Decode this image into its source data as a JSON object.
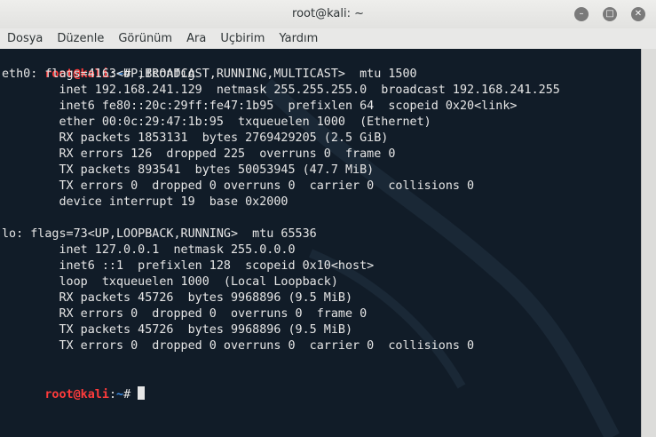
{
  "window": {
    "title": "root@kali: ~"
  },
  "menu": [
    "Dosya",
    "Düzenle",
    "Görünüm",
    "Ara",
    "Uçbirim",
    "Yardım"
  ],
  "terminal": {
    "prompt_user": "root@kali",
    "prompt_sep": ":",
    "prompt_path": "~",
    "prompt_symbol": "# ",
    "command": "ifconfig",
    "output": [
      "eth0: flags=4163<UP,BROADCAST,RUNNING,MULTICAST>  mtu 1500",
      "        inet 192.168.241.129  netmask 255.255.255.0  broadcast 192.168.241.255",
      "        inet6 fe80::20c:29ff:fe47:1b95  prefixlen 64  scopeid 0x20<link>",
      "        ether 00:0c:29:47:1b:95  txqueuelen 1000  (Ethernet)",
      "        RX packets 1853131  bytes 2769429205 (2.5 GiB)",
      "        RX errors 126  dropped 225  overruns 0  frame 0",
      "        TX packets 893541  bytes 50053945 (47.7 MiB)",
      "        TX errors 0  dropped 0 overruns 0  carrier 0  collisions 0",
      "        device interrupt 19  base 0x2000",
      "",
      "lo: flags=73<UP,LOOPBACK,RUNNING>  mtu 65536",
      "        inet 127.0.0.1  netmask 255.0.0.0",
      "        inet6 ::1  prefixlen 128  scopeid 0x10<host>",
      "        loop  txqueuelen 1000  (Local Loopback)",
      "        RX packets 45726  bytes 9968896 (9.5 MiB)",
      "        RX errors 0  dropped 0  overruns 0  frame 0",
      "        TX packets 45726  bytes 9968896 (9.5 MiB)",
      "        TX errors 0  dropped 0 overruns 0  carrier 0  collisions 0",
      ""
    ]
  },
  "icons": {
    "minimize": "minimize-icon",
    "maximize": "maximize-icon",
    "close": "close-icon"
  },
  "colors": {
    "terminal_bg": "#111c28",
    "prompt_user": "#ff3b3b",
    "prompt_path": "#3b8eea",
    "text": "#e6e6e6"
  }
}
